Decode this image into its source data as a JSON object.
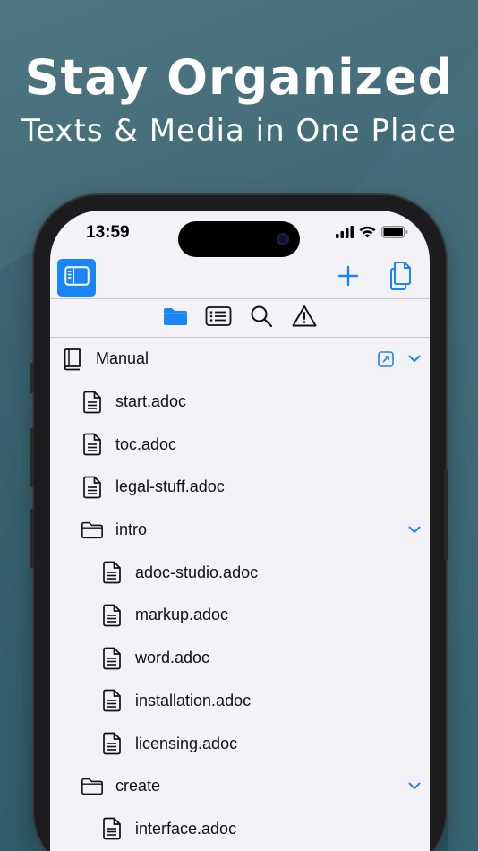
{
  "promo": {
    "headline": "Stay Organized",
    "subheadline": "Texts & Media in One Place"
  },
  "status_bar": {
    "time": "13:59",
    "icons": [
      "cellular-signal-icon",
      "wifi-icon",
      "battery-icon"
    ]
  },
  "toolbar": {
    "sidebar_toggle_icon": "sidebar-icon",
    "add_icon": "plus-icon",
    "copy_icon": "documents-icon",
    "accent": "#1b84f7"
  },
  "tabs": [
    {
      "name": "files",
      "icon": "folder-icon",
      "selected": true
    },
    {
      "name": "outline",
      "icon": "list-icon",
      "selected": false
    },
    {
      "name": "search",
      "icon": "magnifier-icon",
      "selected": false
    },
    {
      "name": "issues",
      "icon": "warning-icon",
      "selected": false
    }
  ],
  "tree": {
    "root": {
      "label": "Manual",
      "icon": "book-icon",
      "expanded": true
    },
    "items": [
      {
        "label": "start.adoc",
        "type": "file",
        "level": 1
      },
      {
        "label": "toc.adoc",
        "type": "file",
        "level": 1
      },
      {
        "label": "legal-stuff.adoc",
        "type": "file",
        "level": 1
      },
      {
        "label": "intro",
        "type": "folder",
        "level": 1,
        "expanded": true
      },
      {
        "label": "adoc-studio.adoc",
        "type": "file",
        "level": 2
      },
      {
        "label": "markup.adoc",
        "type": "file",
        "level": 2
      },
      {
        "label": "word.adoc",
        "type": "file",
        "level": 2
      },
      {
        "label": "installation.adoc",
        "type": "file",
        "level": 2
      },
      {
        "label": "licensing.adoc",
        "type": "file",
        "level": 2
      },
      {
        "label": "create",
        "type": "folder",
        "level": 1,
        "expanded": true
      },
      {
        "label": "interface.adoc",
        "type": "file",
        "level": 2
      }
    ]
  }
}
